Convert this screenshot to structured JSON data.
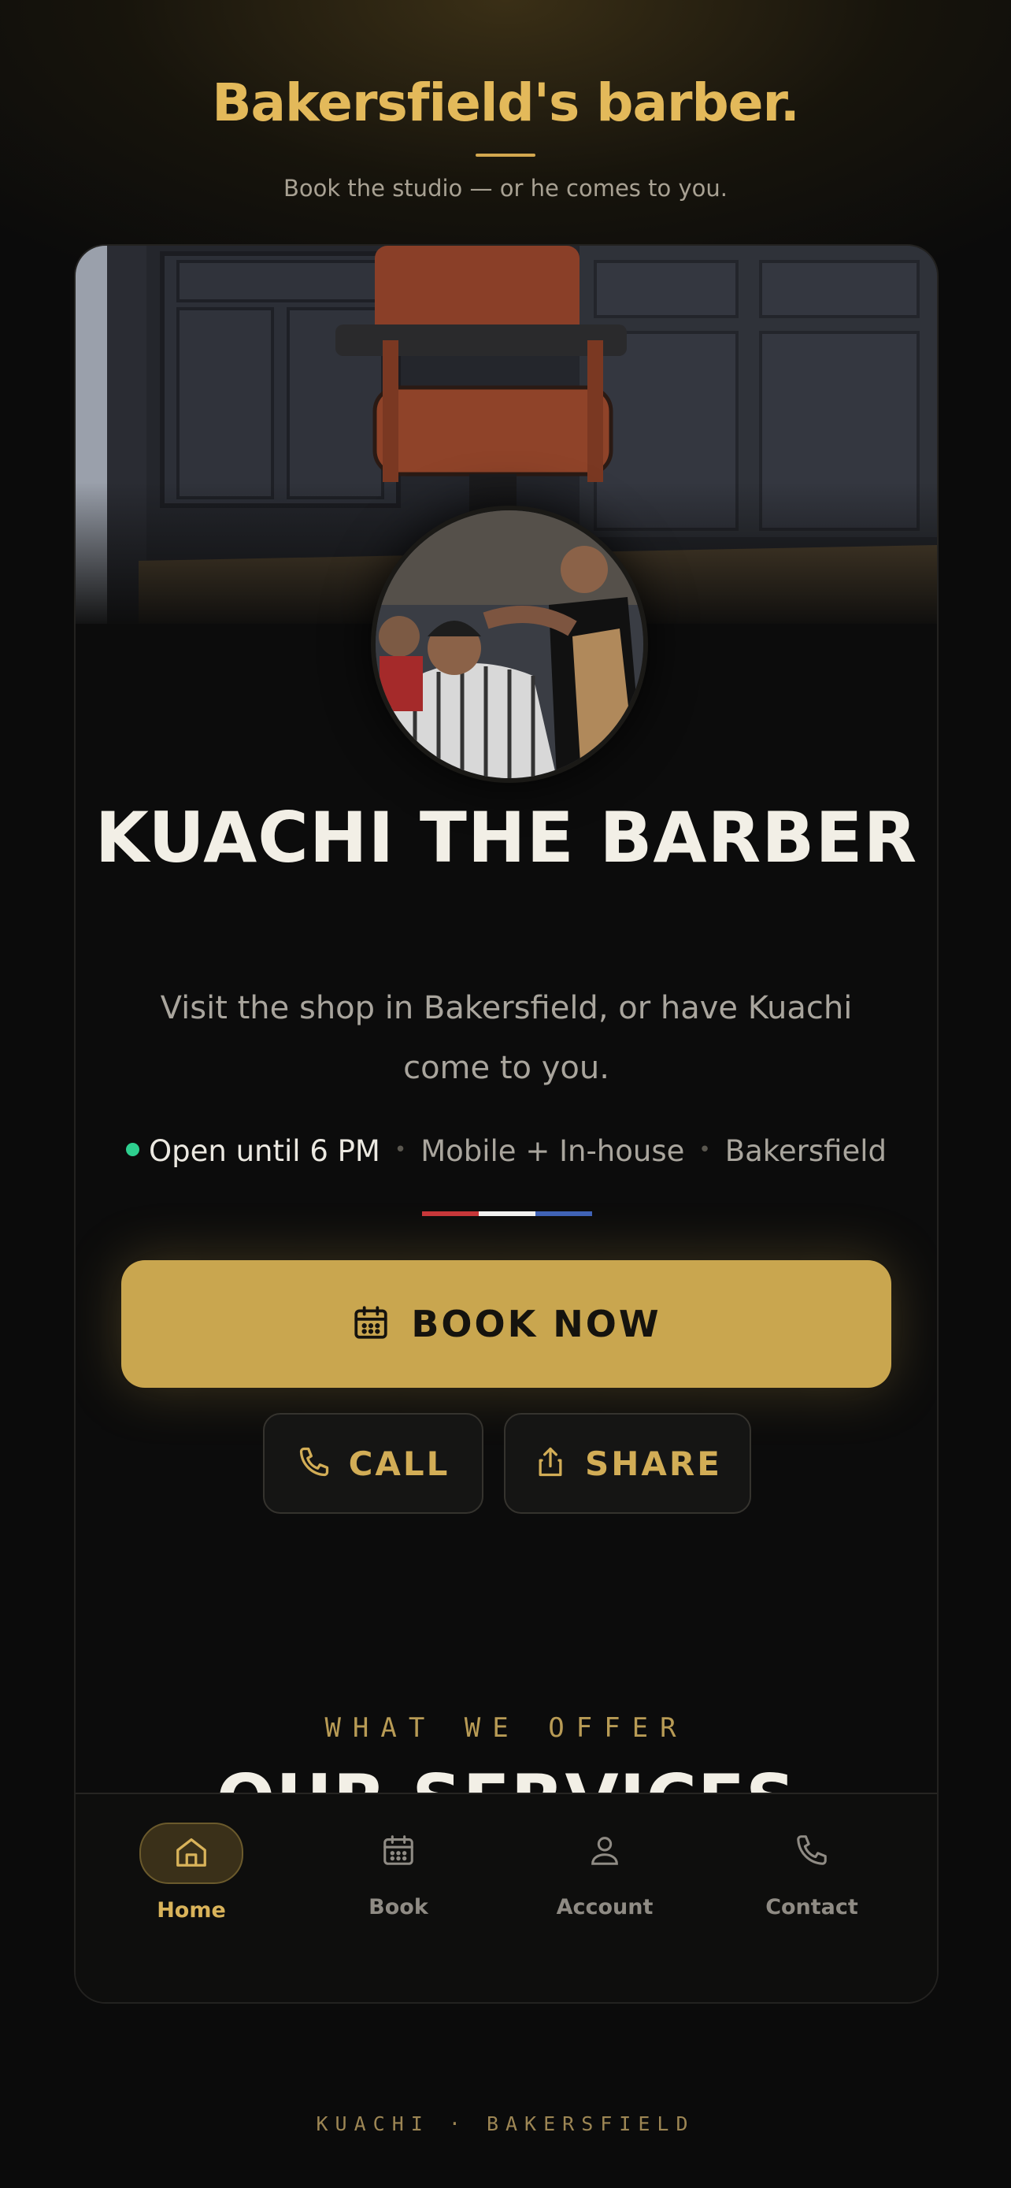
{
  "header": {
    "tagline": "Bakersfield's barber.",
    "subline": "Book the studio — or he comes to you."
  },
  "profile": {
    "name": "KUACHI THE BARBER",
    "description": "Visit the shop in Bakersfield, or have Kuachi come to you.",
    "status": "Open until 6 PM",
    "service_mode": "Mobile + In-house",
    "location": "Bakersfield",
    "status_color": "#2ecf8f"
  },
  "flag_colors": [
    "#c8373a",
    "#f1f1f1",
    "#3f63b8"
  ],
  "actions": {
    "book_label": "BOOK NOW",
    "call_label": "CALL",
    "share_label": "SHARE"
  },
  "services_section": {
    "eyebrow": "WHAT WE OFFER",
    "title": "OUR SERVICES"
  },
  "tabbar": {
    "items": [
      {
        "label": "Home",
        "icon": "home-icon",
        "active": true
      },
      {
        "label": "Book",
        "icon": "calendar-icon",
        "active": false
      },
      {
        "label": "Account",
        "icon": "user-icon",
        "active": false
      },
      {
        "label": "Contact",
        "icon": "phone-icon",
        "active": false
      }
    ]
  },
  "footer": {
    "text": "KUACHI · BAKERSFIELD"
  },
  "colors": {
    "accent": "#c9a64f",
    "accent_text": "#e3b95a",
    "background": "#0b0b0b"
  }
}
